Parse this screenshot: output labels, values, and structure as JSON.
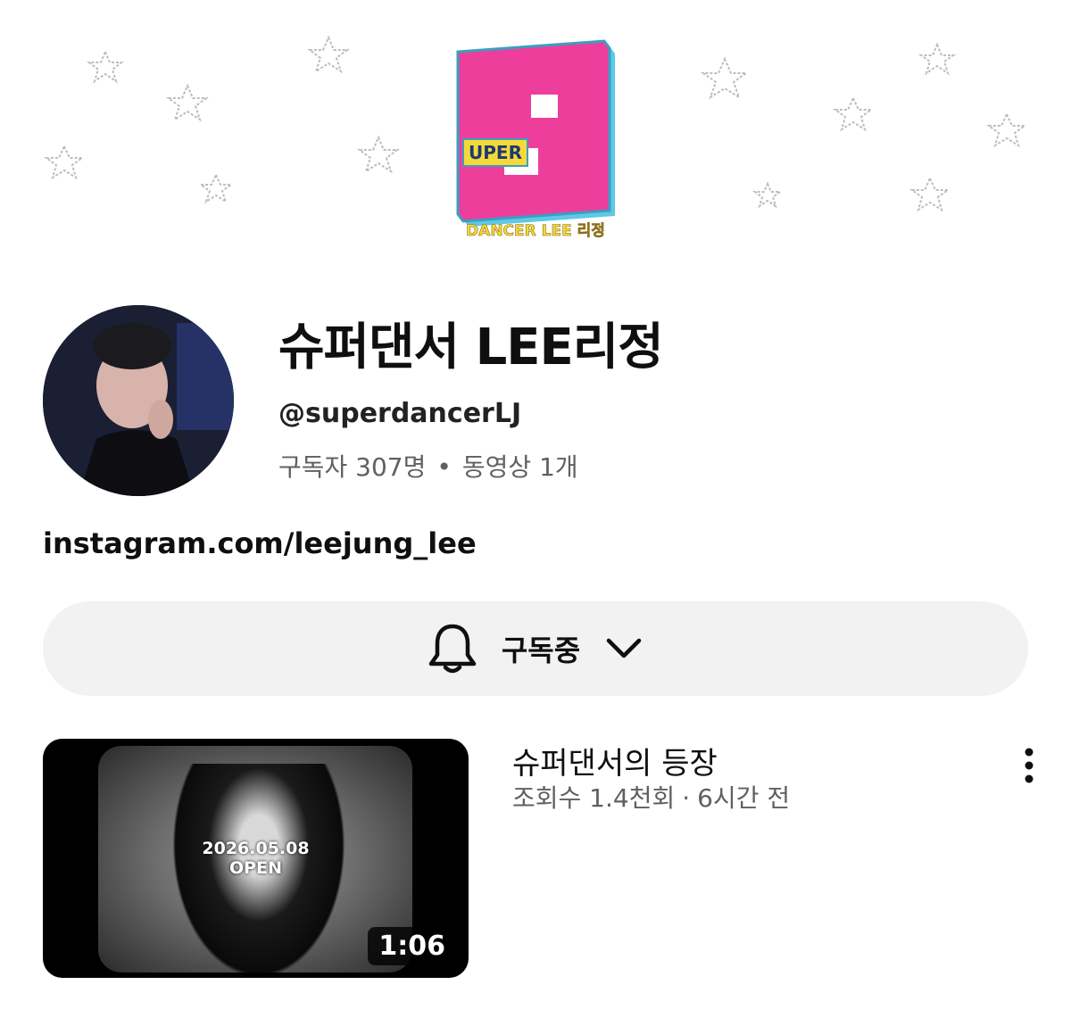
{
  "banner": {
    "logo_big_letter": "S",
    "logo_small_text": "UPER",
    "logo_bottom_text": "DANCER LEE 리정",
    "colors": {
      "pink": "#EE3E9C",
      "cyan": "#5DC9E6",
      "yellow": "#F5D93A"
    }
  },
  "channel": {
    "name": "슈퍼댄서 LEE리정",
    "handle": "@superdancerLJ",
    "subscribers": "구독자 307명",
    "separator": "•",
    "videos": "동영상 1개",
    "link": "instagram.com/leejung_lee"
  },
  "subscribe_button": {
    "label": "구독중",
    "icons": [
      "bell-icon",
      "chevron-down-icon"
    ]
  },
  "video": {
    "title": "슈퍼댄서의 등장",
    "views": "조회수 1.4천회",
    "separator": "·",
    "age": "6시간 전",
    "duration": "1:06",
    "thumb_date": "2026.05.08",
    "thumb_open": "OPEN",
    "menu_icon": "more-vert-icon"
  }
}
